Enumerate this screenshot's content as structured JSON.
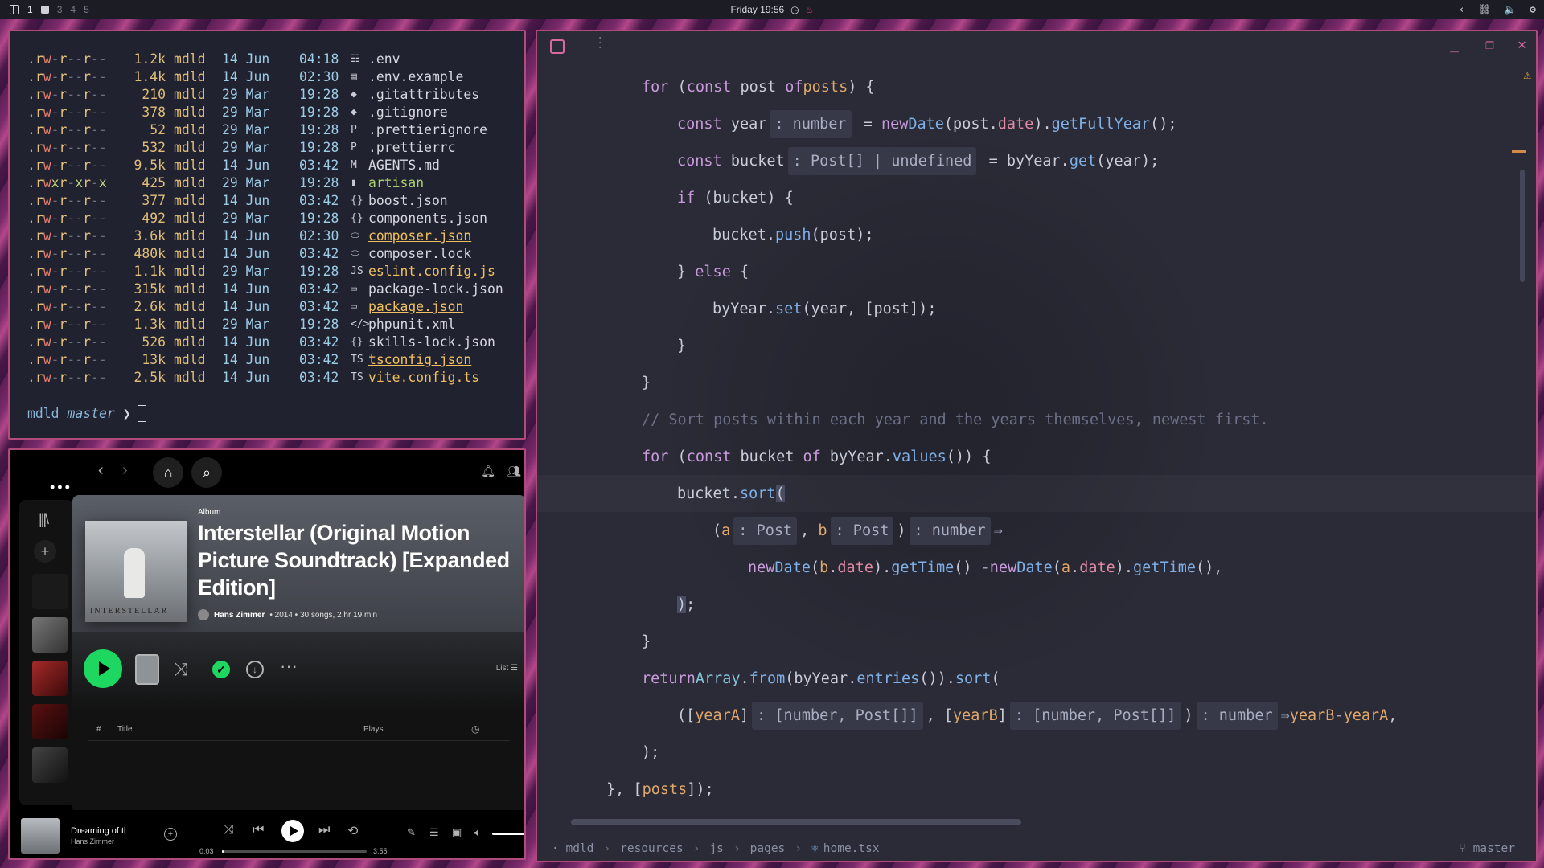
{
  "topbar": {
    "workspaces": [
      "1",
      "3",
      "4",
      "5"
    ],
    "clock": "Friday 19:56",
    "tray_icons": [
      "chevron-left-icon",
      "network-icon",
      "volume-icon",
      "settings-icon"
    ]
  },
  "terminal": {
    "rows": [
      {
        "perm": ".rw-r--r--",
        "size": "1.2k",
        "user": "mdld",
        "date": "14 Jun",
        "time": "04:18",
        "icon": "☷",
        "name": ".env",
        "style": ""
      },
      {
        "perm": ".rw-r--r--",
        "size": "1.4k",
        "user": "mdld",
        "date": "14 Jun",
        "time": "02:30",
        "icon": "▤",
        "name": ".env.example",
        "style": ""
      },
      {
        "perm": ".rw-r--r--",
        "size": "210",
        "user": "mdld",
        "date": "29 Mar",
        "time": "19:28",
        "icon": "◆",
        "name": ".gitattributes",
        "style": ""
      },
      {
        "perm": ".rw-r--r--",
        "size": "378",
        "user": "mdld",
        "date": "29 Mar",
        "time": "19:28",
        "icon": "◆",
        "name": ".gitignore",
        "style": ""
      },
      {
        "perm": ".rw-r--r--",
        "size": "52",
        "user": "mdld",
        "date": "29 Mar",
        "time": "19:28",
        "icon": "P",
        "name": ".prettierignore",
        "style": ""
      },
      {
        "perm": ".rw-r--r--",
        "size": "532",
        "user": "mdld",
        "date": "29 Mar",
        "time": "19:28",
        "icon": "P",
        "name": ".prettierrc",
        "style": ""
      },
      {
        "perm": ".rw-r--r--",
        "size": "9.5k",
        "user": "mdld",
        "date": "14 Jun",
        "time": "03:42",
        "icon": "M",
        "name": "AGENTS.md",
        "style": ""
      },
      {
        "perm": ".rwxr-xr-x",
        "size": "425",
        "user": "mdld",
        "date": "29 Mar",
        "time": "19:28",
        "icon": "▮",
        "name": "artisan",
        "style": "exec"
      },
      {
        "perm": ".rw-r--r--",
        "size": "377",
        "user": "mdld",
        "date": "14 Jun",
        "time": "03:42",
        "icon": "{}",
        "name": "boost.json",
        "style": ""
      },
      {
        "perm": ".rw-r--r--",
        "size": "492",
        "user": "mdld",
        "date": "29 Mar",
        "time": "19:28",
        "icon": "{}",
        "name": "components.json",
        "style": ""
      },
      {
        "perm": ".rw-r--r--",
        "size": "3.6k",
        "user": "mdld",
        "date": "14 Jun",
        "time": "02:30",
        "icon": "⬭",
        "name": "composer.json",
        "style": "hl"
      },
      {
        "perm": ".rw-r--r--",
        "size": "480k",
        "user": "mdld",
        "date": "14 Jun",
        "time": "03:42",
        "icon": "⬭",
        "name": "composer.lock",
        "style": ""
      },
      {
        "perm": ".rw-r--r--",
        "size": "1.1k",
        "user": "mdld",
        "date": "29 Mar",
        "time": "19:28",
        "icon": "JS",
        "name": "eslint.config.js",
        "style": "js"
      },
      {
        "perm": ".rw-r--r--",
        "size": "315k",
        "user": "mdld",
        "date": "14 Jun",
        "time": "03:42",
        "icon": "▭",
        "name": "package-lock.json",
        "style": ""
      },
      {
        "perm": ".rw-r--r--",
        "size": "2.6k",
        "user": "mdld",
        "date": "14 Jun",
        "time": "03:42",
        "icon": "▭",
        "name": "package.json",
        "style": "hl"
      },
      {
        "perm": ".rw-r--r--",
        "size": "1.3k",
        "user": "mdld",
        "date": "29 Mar",
        "time": "19:28",
        "icon": "</>",
        "name": "phpunit.xml",
        "style": ""
      },
      {
        "perm": ".rw-r--r--",
        "size": "526",
        "user": "mdld",
        "date": "14 Jun",
        "time": "03:42",
        "icon": "{}",
        "name": "skills-lock.json",
        "style": ""
      },
      {
        "perm": ".rw-r--r--",
        "size": "13k",
        "user": "mdld",
        "date": "14 Jun",
        "time": "03:42",
        "icon": "TS",
        "name": "tsconfig.json",
        "style": "hl"
      },
      {
        "perm": ".rw-r--r--",
        "size": "2.5k",
        "user": "mdld",
        "date": "14 Jun",
        "time": "03:42",
        "icon": "TS",
        "name": "vite.config.ts",
        "style": "js"
      }
    ],
    "prompt": {
      "dir": "mdld",
      "branch": "master",
      "arrow": "❯"
    }
  },
  "spotify": {
    "album_type": "Album",
    "title": "Interstellar (Original Motion Picture Soundtrack) [Expanded Edition]",
    "artist": "Hans Zimmer",
    "meta": "• 2014 • 30 songs, 2 hr 19 min",
    "cover_text": "INTERSTELLAR",
    "list_label": "List",
    "table": {
      "index": "#",
      "title": "Title",
      "plays": "Plays"
    },
    "now_playing": {
      "title": "Dreaming of the Cr",
      "artist": "Hans Zimmer",
      "elapsed": "0:03",
      "total": "3:55",
      "progress": 0.013
    },
    "accent": "#1ed760"
  },
  "editor": {
    "breadcrumb": [
      "mdld",
      "resources",
      "js",
      "pages",
      "home.tsx"
    ],
    "branch": "master",
    "comment": "// Sort posts within each year and the years themselves, newest first."
  }
}
